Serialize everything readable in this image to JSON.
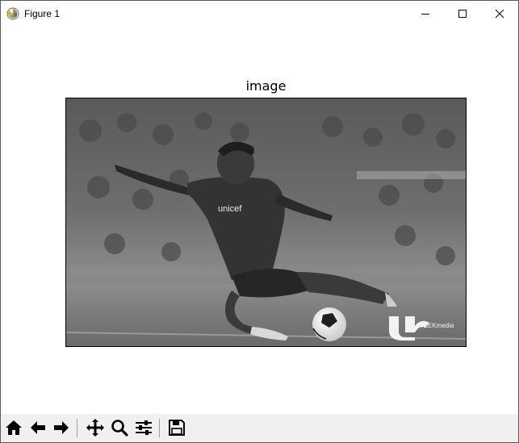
{
  "window": {
    "title": "Figure 1"
  },
  "figure": {
    "axes_title": "image"
  },
  "image": {
    "jersey_text": "unicef",
    "watermark": "WEEKmedia"
  },
  "toolbar": {
    "buttons": [
      {
        "name": "home",
        "icon": "home-icon"
      },
      {
        "name": "back",
        "icon": "arrow-left-icon"
      },
      {
        "name": "forward",
        "icon": "arrow-right-icon"
      },
      {
        "name": "pan",
        "icon": "move-icon"
      },
      {
        "name": "zoom",
        "icon": "magnifier-icon"
      },
      {
        "name": "subplots",
        "icon": "sliders-icon"
      },
      {
        "name": "save",
        "icon": "floppy-icon"
      }
    ]
  }
}
